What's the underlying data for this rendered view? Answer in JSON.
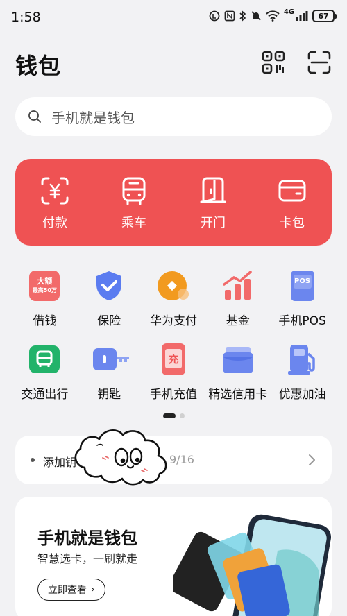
{
  "status_bar": {
    "time": "1:58",
    "network": "4G",
    "battery": "67"
  },
  "header": {
    "title": "钱包"
  },
  "search": {
    "placeholder": "手机就是钱包"
  },
  "quick_actions": [
    {
      "label": "付款",
      "icon": "payment-code-icon"
    },
    {
      "label": "乘车",
      "icon": "bus-icon"
    },
    {
      "label": "开门",
      "icon": "door-icon"
    },
    {
      "label": "卡包",
      "icon": "card-wallet-icon"
    }
  ],
  "services_row1": [
    {
      "label": "借钱",
      "icon": "loan-icon",
      "badge_line1": "大额",
      "badge_line2": "最高50万"
    },
    {
      "label": "保险",
      "icon": "shield-icon"
    },
    {
      "label": "华为支付",
      "icon": "huawei-pay-icon"
    },
    {
      "label": "基金",
      "icon": "fund-chart-icon"
    },
    {
      "label": "手机POS",
      "icon": "pos-icon",
      "badge": "POS"
    }
  ],
  "services_row2": [
    {
      "label": "交通出行",
      "icon": "transit-icon"
    },
    {
      "label": "钥匙",
      "icon": "key-icon"
    },
    {
      "label": "手机充值",
      "icon": "phone-topup-icon",
      "badge": "充"
    },
    {
      "label": "精选信用卡",
      "icon": "credit-card-icon"
    },
    {
      "label": "优惠加油",
      "icon": "fuel-icon"
    }
  ],
  "notice": {
    "text": "添加钥",
    "date": "9/16"
  },
  "promo": {
    "title": "手机就是钱包",
    "subtitle": "智慧选卡，一刷就走",
    "button": "立即查看",
    "chevron": "›"
  },
  "colors": {
    "accent": "#ef5253",
    "background": "#f2f2f4"
  }
}
